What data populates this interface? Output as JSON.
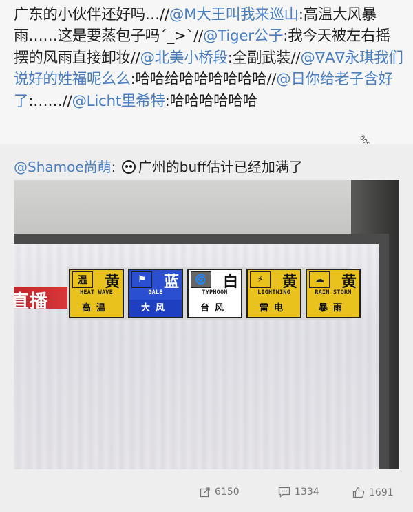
{
  "post": {
    "segments": [
      {
        "t": "广东的小伙伴还好吗…//",
        "m": false
      },
      {
        "t": "@M大王叫我来巡山",
        "m": true
      },
      {
        "t": ":高温大风暴雨……这是要蒸包子吗´_>`//",
        "m": false
      },
      {
        "t": "@Tiger公子",
        "m": true
      },
      {
        "t": ":我今天被左右摇摆的风雨直接卸妆//",
        "m": false
      },
      {
        "t": "@北美小桥段",
        "m": true
      },
      {
        "t": ":全副武装//",
        "m": false
      },
      {
        "t": "@ᐁAᐁ永琪我们说好的姓福呢么么",
        "m": true
      },
      {
        "t": ":哈哈给哈哈哈哈哈哈//",
        "m": false
      },
      {
        "t": "@日你给老子含好了",
        "m": true
      },
      {
        "t": ":……//",
        "m": false
      },
      {
        "t": "@Licht里希特",
        "m": true
      },
      {
        "t": ":哈哈哈哈哈哈",
        "m": false
      }
    ]
  },
  "watermark": "QQ564849768",
  "repost": {
    "author": "@Shamoe尚萌",
    "colon": ": ",
    "text": "广州的buff估计已经加满了",
    "emoji_icon": "grinning-face-icon"
  },
  "photo": {
    "live_label": "直播",
    "live_arrow": "《",
    "signals": [
      {
        "icon_char": "温",
        "level": "黄",
        "en": "HEAT WAVE",
        "cn": "高温",
        "color": "#e9c21e",
        "icon_bg": "#e9c21e",
        "cn_bg": "#e9c21e",
        "icon_name": "thermometer-icon"
      },
      {
        "icon_char": "⚑",
        "level": "蓝",
        "en": "GALE",
        "cn": "大风",
        "color": "#2a4fd0",
        "icon_bg": "#2a4fd0",
        "cn_bg": "#1e3fc0",
        "icon_name": "flag-icon"
      },
      {
        "icon_char": "🌀",
        "level": "白",
        "en": "TYPHOON",
        "cn": "台风",
        "color": "#ffffff",
        "icon_bg": "#666666",
        "cn_bg": "#ffffff",
        "icon_name": "typhoon-icon"
      },
      {
        "icon_char": "⚡",
        "level": "黄",
        "en": "LIGHTNING",
        "cn": "雷电",
        "color": "#e9c21e",
        "icon_bg": "#e9c21e",
        "cn_bg": "#e9c21e",
        "icon_name": "lightning-icon"
      },
      {
        "icon_char": "☁",
        "level": "黄",
        "en": "RAIN STORM",
        "cn": "暴雨",
        "color": "#e9c21e",
        "icon_bg": "#e9c21e",
        "cn_bg": "#e9c21e",
        "icon_name": "rainstorm-icon"
      }
    ]
  },
  "stats": {
    "repost_count": "6150",
    "comment_count": "1334",
    "like_count": "1691",
    "color": "#777777"
  }
}
